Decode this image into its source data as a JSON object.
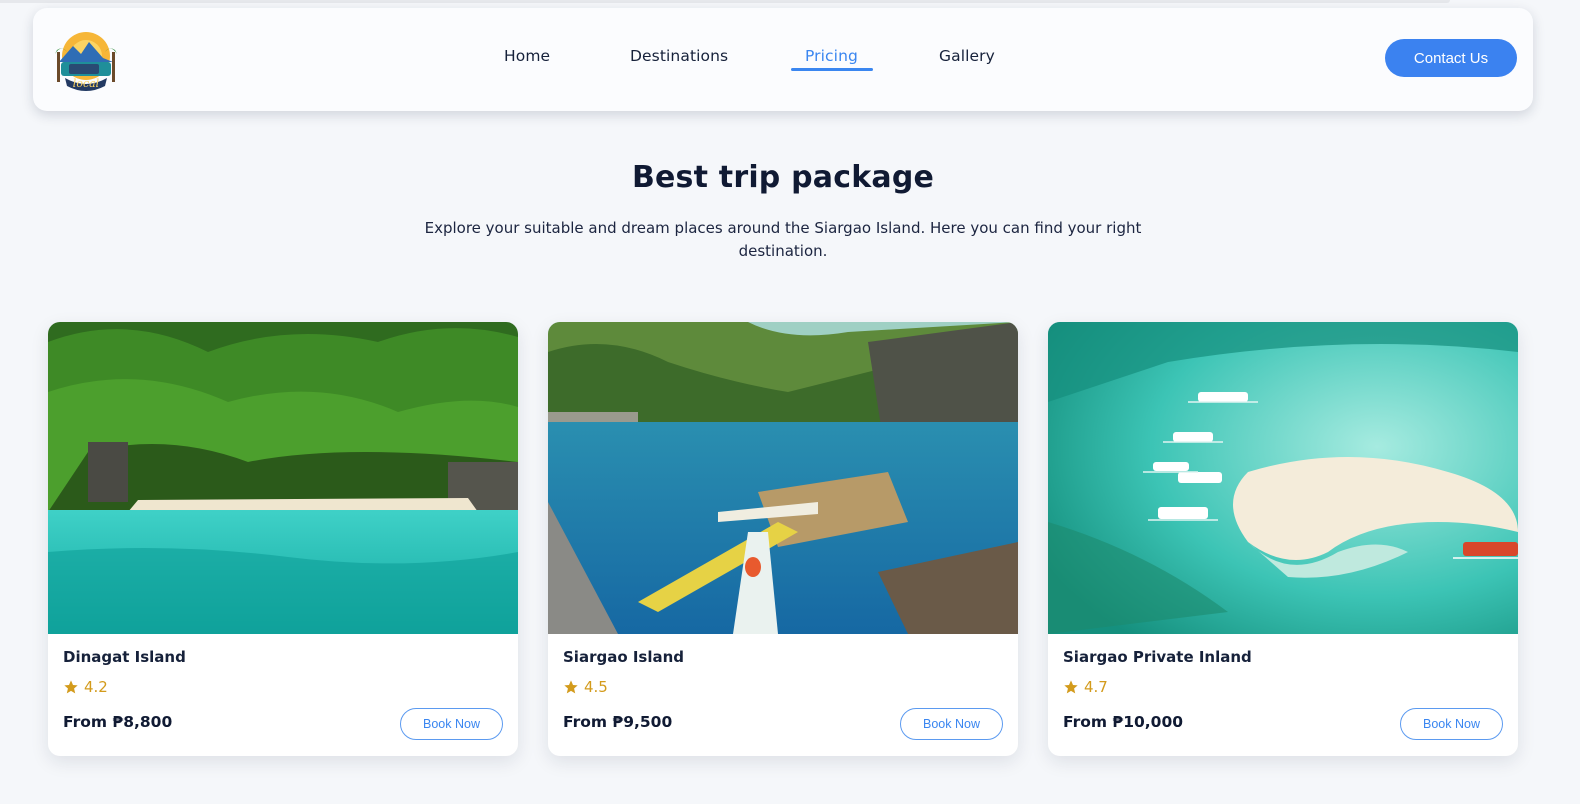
{
  "nav": {
    "links": [
      "Home",
      "Destinations",
      "Pricing",
      "Gallery"
    ],
    "active": "Pricing",
    "contact_label": "Contact Us"
  },
  "hero": {
    "title": "Best trip package",
    "subtitle": "Explore your suitable and dream places around the Siargao Island. Here you can find your right destination."
  },
  "packages": [
    {
      "name": "Dinagat Island",
      "rating": "4.2",
      "price": "From ₱8,800",
      "cta": "Book Now"
    },
    {
      "name": "Siargao Island",
      "rating": "4.5",
      "price": "From ₱9,500",
      "cta": "Book Now"
    },
    {
      "name": "Siargao Private Inland",
      "rating": "4.7",
      "price": "From ₱10,000",
      "cta": "Book Now"
    }
  ],
  "colors": {
    "accent": "#3b82f0",
    "star": "#d39b1c",
    "heading": "#101a33"
  }
}
